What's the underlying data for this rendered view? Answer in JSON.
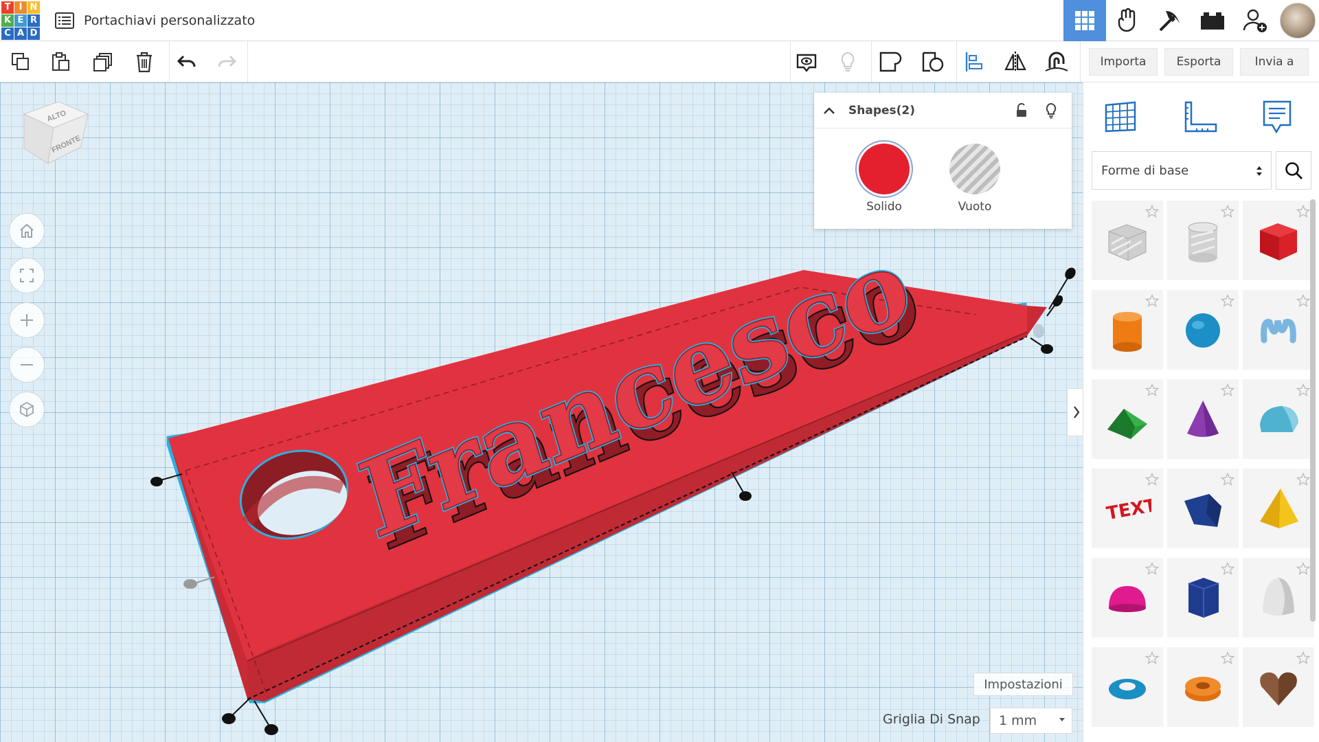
{
  "app": {
    "logo_letters": [
      "T",
      "I",
      "N",
      "K",
      "E",
      "R",
      "C",
      "A",
      "D"
    ],
    "logo_colors": [
      "#e8402a",
      "#f08a2c",
      "#f7bd2a",
      "#4fae4b",
      "#3f9cd1",
      "#2a6cc1",
      "#2a6cc1",
      "#2a6cc1",
      "#2a6cc1"
    ],
    "document_title": "Portachiavi personalizzato"
  },
  "header_icons": [
    "grid-view-icon",
    "gesture-hand-icon",
    "pickaxe-icon",
    "bricks-icon",
    "add-user-icon",
    "user-avatar"
  ],
  "toolbar": {
    "import_label": "Importa",
    "export_label": "Esporta",
    "send_label": "Invia a"
  },
  "workplane": {
    "viewcube_top": "ALTO",
    "viewcube_front": "FRONTE",
    "model_text": "Francesco",
    "settings_label": "Impostazioni",
    "snap_label": "Griglia Di Snap",
    "snap_value": "1 mm",
    "accent_color": "#2ab0e2",
    "model_color": "#e0333f"
  },
  "inspector": {
    "title": "Shapes(2)",
    "solid_label": "Solido",
    "hole_label": "Vuoto",
    "solid_color": "#e4202e"
  },
  "library": {
    "category": "Forme di base",
    "shapes": [
      "Box (hole)",
      "Cylinder (hole)",
      "Box",
      "Cylinder",
      "Sphere",
      "Scribble",
      "Roof",
      "Cone",
      "Round Roof",
      "Text",
      "Wedge",
      "Pyramid",
      "Half Sphere",
      "Polygon",
      "Paraboloid",
      "Tube",
      "Torus",
      "Heart"
    ]
  }
}
